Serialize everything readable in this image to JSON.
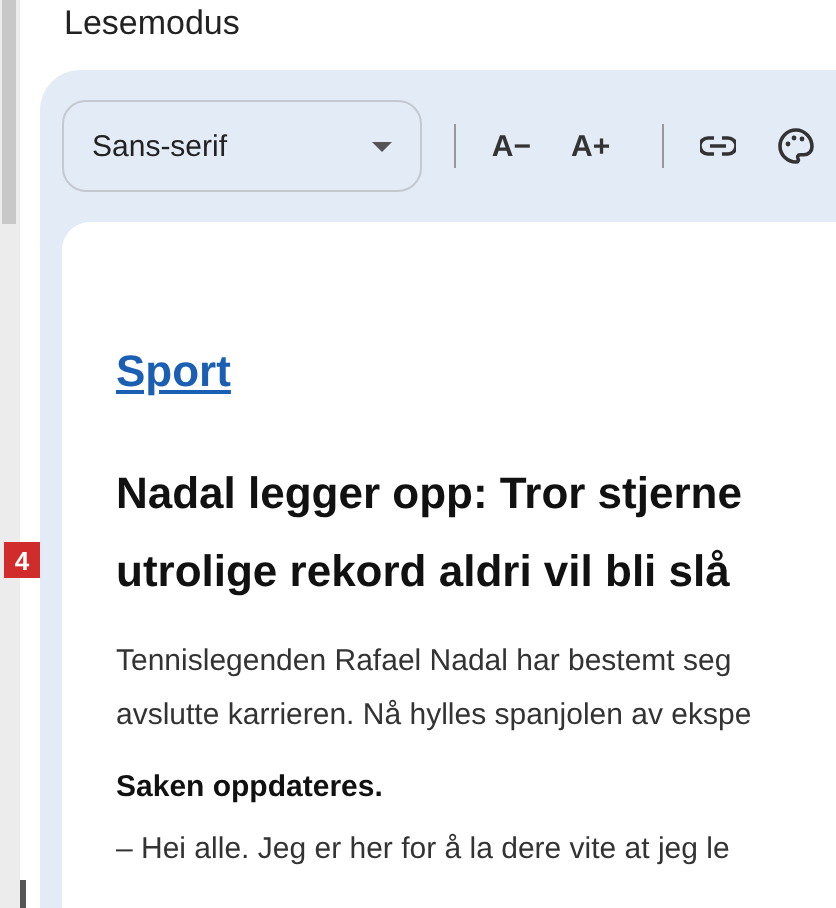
{
  "title": "Lesemodus",
  "toolbar": {
    "font_select": {
      "value": "Sans-serif"
    },
    "buttons": [
      {
        "kind": "text",
        "label": "A−"
      },
      {
        "kind": "text",
        "label": "A+"
      },
      {
        "kind": "link"
      },
      {
        "kind": "palette"
      }
    ]
  },
  "marker": "4",
  "article": {
    "section_link": "Sport",
    "headline_lines": [
      "Nadal legger opp: Tror stjerne",
      "utrolige rekord aldri vil bli slå"
    ],
    "intro_lines": [
      "Tennislegenden Rafael Nadal har bestemt seg",
      "avslutte karrieren. Nå hylles spanjolen av ekspe"
    ],
    "update_note": "Saken oppdateres.",
    "quote_line": "– Hei alle. Jeg er her for å la dere vite at jeg le"
  }
}
